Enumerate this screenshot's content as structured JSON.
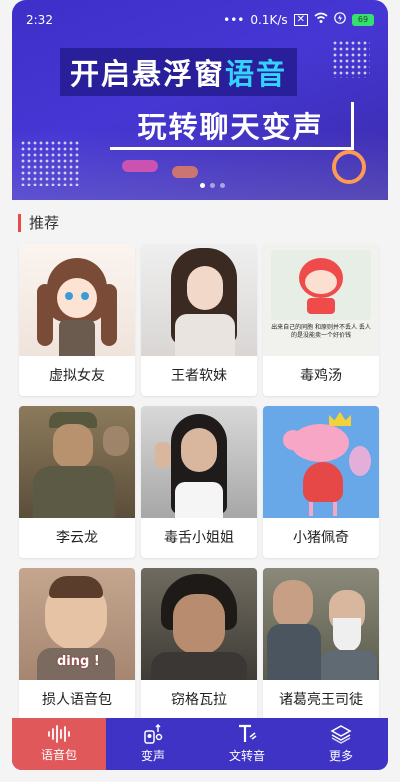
{
  "status_bar": {
    "time": "2:32",
    "network_speed": "0.1K/s",
    "battery": "69"
  },
  "banner": {
    "line1_text": "开启悬浮窗",
    "line1_accent": "语音",
    "line2_text": "玩转聊天变声",
    "page_count": 3,
    "active_page": 1
  },
  "section": {
    "title": "推荐"
  },
  "cards": [
    {
      "label": "虚拟女友",
      "icon": "anime-girl-image"
    },
    {
      "label": "王者软妹",
      "icon": "girl-photo-image"
    },
    {
      "label": "毒鸡汤",
      "icon": "cartoon-cat-image",
      "caption": "出来自己的同胞 和原则并不丢人 丢人的是没能卖一个好价钱"
    },
    {
      "label": "李云龙",
      "icon": "soldier-photo-image"
    },
    {
      "label": "毒舌小姐姐",
      "icon": "girl-selfie-image"
    },
    {
      "label": "小猪佩奇",
      "icon": "peppa-pig-image"
    },
    {
      "label": "损人语音包",
      "icon": "baby-photo-image",
      "caption": "ding !"
    },
    {
      "label": "窃格瓦拉",
      "icon": "man-photo-image"
    },
    {
      "label": "诸葛亮王司徒",
      "icon": "drama-still-image"
    }
  ],
  "tabs": [
    {
      "label": "语音包",
      "icon": "waveform-icon",
      "active": true
    },
    {
      "label": "变声",
      "icon": "voice-change-icon",
      "active": false
    },
    {
      "label": "文转音",
      "icon": "text-to-speech-icon",
      "active": false
    },
    {
      "label": "更多",
      "icon": "layers-icon",
      "active": false
    }
  ],
  "colors": {
    "header": "#4637d4",
    "accent_text": "#34d3ff",
    "tab_active": "#e0585a",
    "tabbar": "#3e33c4",
    "section_marker": "#e84a4a"
  }
}
